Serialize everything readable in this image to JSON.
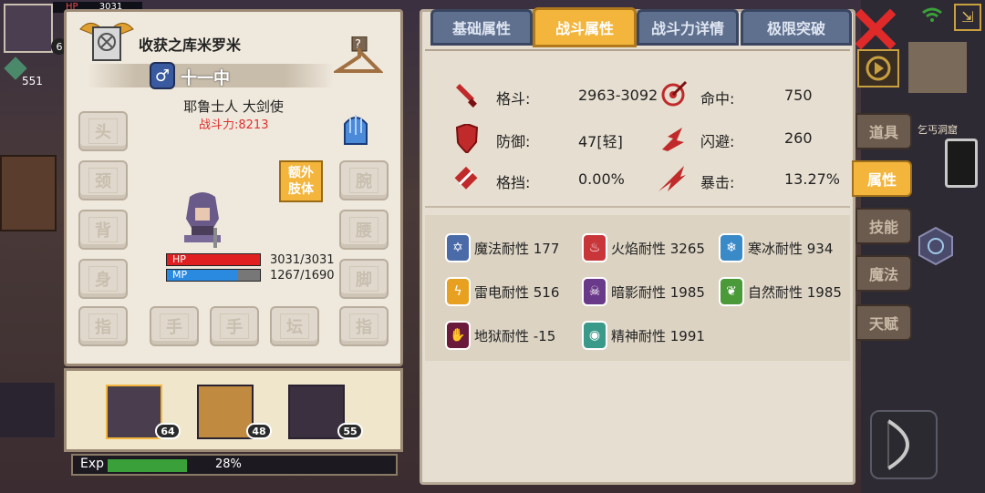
{
  "hud": {
    "hp_label": "HP",
    "hp_value": "3031",
    "player_level": "6",
    "gem_count": "551"
  },
  "character": {
    "title_name": "收获之库米罗米",
    "gender_icon": "male-icon",
    "level_text": "十一中",
    "class_text": "耶鲁士人 大剑使",
    "power_text": "战斗力:8213",
    "extra_limbs_button": "额外\n肢体",
    "hp_label": "HP",
    "hp_text": "3031/3031",
    "hp_fraction": 1.0,
    "mp_label": "MP",
    "mp_text": "1267/1690",
    "mp_fraction": 0.75
  },
  "equipment_slots": {
    "head": "头",
    "neck": "颈",
    "back": "背",
    "body": "身",
    "finger_left": "指",
    "wrist": "腕",
    "waist": "腰",
    "leg": "脚",
    "finger_right": "指",
    "hand_1": "手",
    "hand_2": "手",
    "ring": "坛"
  },
  "team": [
    {
      "level": "64"
    },
    {
      "level": "48"
    },
    {
      "level": "55"
    }
  ],
  "exp": {
    "label": "Exp",
    "percent_text": "28%",
    "fraction": 0.28
  },
  "tabs": [
    {
      "label": "基础属性"
    },
    {
      "label": "战斗属性"
    },
    {
      "label": "战斗力详情"
    },
    {
      "label": "极限突破"
    }
  ],
  "combat_stats": {
    "attack_label": "格斗:",
    "attack_value": "2963-3092",
    "hit_label": "命中:",
    "hit_value": "750",
    "defense_label": "防御:",
    "defense_value": "47[轻]",
    "dodge_label": "闪避:",
    "dodge_value": "260",
    "block_label": "格挡:",
    "block_value": "0.00%",
    "crit_label": "暴击:",
    "crit_value": "13.27%"
  },
  "resistances": [
    {
      "label": "魔法耐性 177",
      "icon": "star-of-david-icon",
      "color": "#4a6aa8"
    },
    {
      "label": "火焰耐性 3265",
      "icon": "flame-icon",
      "color": "#c8363a"
    },
    {
      "label": "寒冰耐性 934",
      "icon": "snowflake-icon",
      "color": "#3a8ac8"
    },
    {
      "label": "雷电耐性 516",
      "icon": "lightning-icon",
      "color": "#e8a020"
    },
    {
      "label": "暗影耐性 1985",
      "icon": "skull-icon",
      "color": "#6a3a8a"
    },
    {
      "label": "自然耐性 1985",
      "icon": "leaf-icon",
      "color": "#4a9a3a"
    },
    {
      "label": "地狱耐性 -15",
      "icon": "hand-icon",
      "color": "#6a1a3a"
    },
    {
      "label": "精神耐性 1991",
      "icon": "eye-icon",
      "color": "#3a9a8a"
    }
  ],
  "side_tabs": [
    {
      "label": "道具"
    },
    {
      "label": "属性"
    },
    {
      "label": "技能"
    },
    {
      "label": "魔法"
    },
    {
      "label": "天赋"
    }
  ],
  "map": {
    "location_label": "乞丐洞窟"
  },
  "colors": {
    "active_tab": "#f3b53c",
    "inactive_tab": "#5f6f8e",
    "hp_bar": "#e02020",
    "mp_bar": "#2a8ae0",
    "exp_bar": "#3aa03a",
    "power_text": "#e03030"
  }
}
